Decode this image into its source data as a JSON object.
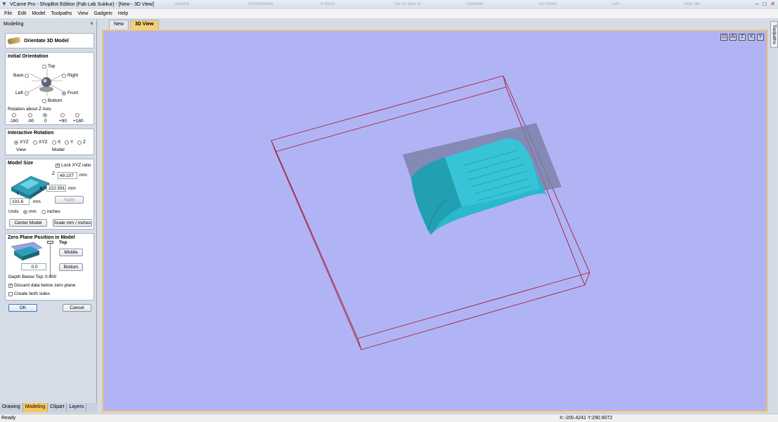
{
  "window": {
    "title": "VCarve Pro - ShopBot Edition (Fab Lab Sukkur) - [New - 3D View]",
    "background_tabs": [
      "Scaling",
      "contemplative ·",
      "Is there...",
      "The 10 laws of…",
      "Orientate",
      "3D model",
      "Lam",
      "New tab"
    ],
    "controls": [
      "–",
      "□",
      "✕"
    ]
  },
  "menu": [
    "File",
    "Edit",
    "Model",
    "Toolpaths",
    "View",
    "Gadgets",
    "Help"
  ],
  "left_panel": {
    "header": "Modeling",
    "pin": "ᵠ",
    "orientate_title": "Orientate 3D Model",
    "initial_orientation": {
      "heading": "Initial Orientation",
      "top": "Top",
      "back": "Back",
      "right": "Right",
      "left": "Left",
      "front": "Front",
      "bottom": "Bottom",
      "rotation_label": "Rotation about Z Axis",
      "rotations": [
        "-180",
        "-90",
        "0",
        "+90",
        "+180"
      ]
    },
    "interactive_rotation": {
      "heading": "Interactive Rotation",
      "options": [
        "XYZ",
        "XYZ",
        "X",
        "Y",
        "Z"
      ],
      "view_label": "View",
      "model_label": "Model"
    },
    "model_size": {
      "heading": "Model Size",
      "lock_label": "Lock XYZ ratio",
      "z_value": "49.107",
      "x_value": "222.591",
      "y_value": "101.6",
      "unit_mm": "mm",
      "apply": "Apply",
      "units_label": "Units",
      "mm": "mm",
      "inches": "inches",
      "center_model": "Center Model",
      "scale_btn": "Scale mm / inches",
      "axis_z": "Z",
      "axis_x": "X",
      "axis_y": "Y"
    },
    "zero_plane": {
      "heading": "Zero Plane Position in Model",
      "top": "Top",
      "middle": "Middle",
      "bottom": "Bottom",
      "value": "0.0",
      "depth_label": "Depth Below Top:",
      "depth_value": "0.000",
      "discard_label": "Discard data below zero plane",
      "both_sides_label": "Create both sides"
    },
    "ok": "OK",
    "cancel": "Cancel",
    "bottom_tabs": [
      "Drawing",
      "Modeling",
      "Clipart",
      "Layers"
    ]
  },
  "doc_tabs": [
    "New",
    "3D View"
  ],
  "view_icons": [
    "⊡",
    "⁂",
    "Z",
    "X",
    "Y"
  ],
  "right_tab": "Toolpaths",
  "status": {
    "ready": "Ready",
    "coords": "X:-200.4241 Y:290.9072"
  },
  "colors": {
    "viewport_bg": "#b1b4f4",
    "model_cyan": "#2ab8cc",
    "bounding_box": "#a0203a",
    "active_tab": "#f5c75a"
  }
}
